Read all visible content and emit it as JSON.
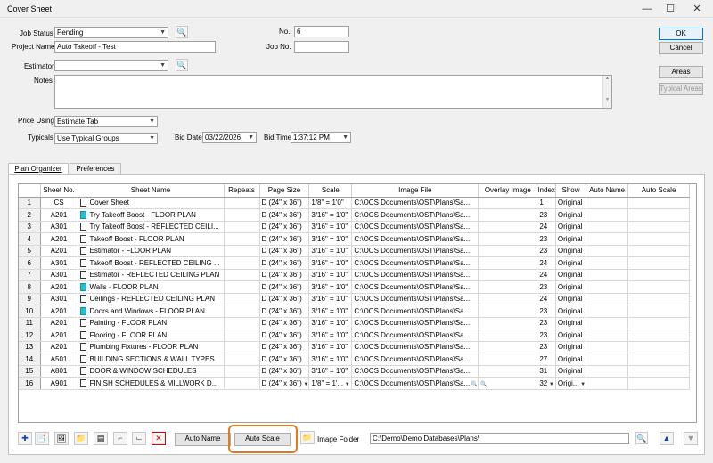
{
  "window": {
    "title": "Cover Sheet",
    "min": "—",
    "max": "☐",
    "close": "✕"
  },
  "form": {
    "job_status_label": "Job Status",
    "job_status_value": "Pending",
    "project_name_label": "Project Name",
    "project_name_value": "Auto Takeoff - Test",
    "estimator_label": "Estimator",
    "estimator_value": "",
    "notes_label": "Notes",
    "no_label": "No.",
    "no_value": "6",
    "job_no_label": "Job No.",
    "job_no_value": "",
    "price_using_label": "Price Using",
    "price_using_value": "Estimate Tab",
    "typicals_label": "Typicals",
    "typicals_value": "Use Typical Groups",
    "bid_date_label": "Bid Date",
    "bid_date_value": "03/22/2026",
    "bid_time_label": "Bid Time",
    "bid_time_value": "1:37:12 PM"
  },
  "buttons": {
    "ok": "OK",
    "cancel": "Cancel",
    "areas": "Areas",
    "typical_areas": "Typical Areas"
  },
  "tabs": [
    {
      "label": "Plan Organizer"
    },
    {
      "label": "Preferences"
    }
  ],
  "grid": {
    "columns": [
      "",
      "Sheet No.",
      "Sheet Name",
      "Repeats",
      "Page Size",
      "Scale",
      "Image File",
      "Overlay Image",
      "Index",
      "Show",
      "Auto Name",
      "Auto Scale"
    ],
    "rows": [
      {
        "n": "1",
        "sheet_no": "CS",
        "name": "Cover Sheet",
        "icon": "plain",
        "page_size": "D (24\" x 36\")",
        "scale": "1/8\" = 1'0\"",
        "image": "C:\\OCS Documents\\OST\\Plans\\Sa...",
        "index": "1",
        "show": "Original"
      },
      {
        "n": "2",
        "sheet_no": "A201",
        "name": "Try Takeoff Boost - FLOOR PLAN",
        "icon": "cyan",
        "page_size": "D (24\" x 36\")",
        "scale": "3/16\" = 1'0\"",
        "image": "C:\\OCS Documents\\OST\\Plans\\Sa...",
        "index": "23",
        "show": "Original"
      },
      {
        "n": "3",
        "sheet_no": "A301",
        "name": "Try Takeoff Boost - REFLECTED CEILI...",
        "icon": "plain",
        "page_size": "D (24\" x 36\")",
        "scale": "3/16\" = 1'0\"",
        "image": "C:\\OCS Documents\\OST\\Plans\\Sa...",
        "index": "24",
        "show": "Original"
      },
      {
        "n": "4",
        "sheet_no": "A201",
        "name": "Takeoff Boost - FLOOR PLAN",
        "icon": "plain",
        "page_size": "D (24\" x 36\")",
        "scale": "3/16\" = 1'0\"",
        "image": "C:\\OCS Documents\\OST\\Plans\\Sa...",
        "index": "23",
        "show": "Original"
      },
      {
        "n": "5",
        "sheet_no": "A201",
        "name": "Estimator - FLOOR PLAN",
        "icon": "plain",
        "page_size": "D (24\" x 36\")",
        "scale": "3/16\" = 1'0\"",
        "image": "C:\\OCS Documents\\OST\\Plans\\Sa...",
        "index": "23",
        "show": "Original"
      },
      {
        "n": "6",
        "sheet_no": "A301",
        "name": "Takeoff Boost - REFLECTED CEILING ...",
        "icon": "plain",
        "page_size": "D (24\" x 36\")",
        "scale": "3/16\" = 1'0\"",
        "image": "C:\\OCS Documents\\OST\\Plans\\Sa...",
        "index": "24",
        "show": "Original"
      },
      {
        "n": "7",
        "sheet_no": "A301",
        "name": "Estimator - REFLECTED CEILING PLAN",
        "icon": "plain",
        "page_size": "D (24\" x 36\")",
        "scale": "3/16\" = 1'0\"",
        "image": "C:\\OCS Documents\\OST\\Plans\\Sa...",
        "index": "24",
        "show": "Original"
      },
      {
        "n": "8",
        "sheet_no": "A201",
        "name": "Walls - FLOOR PLAN",
        "icon": "cyan",
        "page_size": "D (24\" x 36\")",
        "scale": "3/16\" = 1'0\"",
        "image": "C:\\OCS Documents\\OST\\Plans\\Sa...",
        "index": "23",
        "show": "Original"
      },
      {
        "n": "9",
        "sheet_no": "A301",
        "name": "Ceilings - REFLECTED CEILING PLAN",
        "icon": "plain",
        "page_size": "D (24\" x 36\")",
        "scale": "3/16\" = 1'0\"",
        "image": "C:\\OCS Documents\\OST\\Plans\\Sa...",
        "index": "24",
        "show": "Original"
      },
      {
        "n": "10",
        "sheet_no": "A201",
        "name": "Doors and Windows - FLOOR PLAN",
        "icon": "cyan",
        "page_size": "D (24\" x 36\")",
        "scale": "3/16\" = 1'0\"",
        "image": "C:\\OCS Documents\\OST\\Plans\\Sa...",
        "index": "23",
        "show": "Original"
      },
      {
        "n": "11",
        "sheet_no": "A201",
        "name": "Painting - FLOOR PLAN",
        "icon": "plain",
        "page_size": "D (24\" x 36\")",
        "scale": "3/16\" = 1'0\"",
        "image": "C:\\OCS Documents\\OST\\Plans\\Sa...",
        "index": "23",
        "show": "Original"
      },
      {
        "n": "12",
        "sheet_no": "A201",
        "name": "Flooring - FLOOR PLAN",
        "icon": "plain",
        "page_size": "D (24\" x 36\")",
        "scale": "3/16\" = 1'0\"",
        "image": "C:\\OCS Documents\\OST\\Plans\\Sa...",
        "index": "23",
        "show": "Original"
      },
      {
        "n": "13",
        "sheet_no": "A201",
        "name": "Plumbing Fixtures - FLOOR PLAN",
        "icon": "plain",
        "page_size": "D (24\" x 36\")",
        "scale": "3/16\" = 1'0\"",
        "image": "C:\\OCS Documents\\OST\\Plans\\Sa...",
        "index": "23",
        "show": "Original"
      },
      {
        "n": "14",
        "sheet_no": "A501",
        "name": "BUILDING SECTIONS & WALL TYPES",
        "icon": "plain",
        "page_size": "D (24\" x 36\")",
        "scale": "3/16\" = 1'0\"",
        "image": "C:\\OCS Documents\\OST\\Plans\\Sa...",
        "index": "27",
        "show": "Original"
      },
      {
        "n": "15",
        "sheet_no": "A801",
        "name": "DOOR & WINDOW SCHEDULES",
        "icon": "plain",
        "page_size": "D (24\" x 36\")",
        "scale": "3/16\" = 1'0\"",
        "image": "C:\\OCS Documents\\OST\\Plans\\Sa...",
        "index": "31",
        "show": "Original"
      },
      {
        "n": "16",
        "sheet_no": "A901",
        "name": "FINISH SCHEDULES & MILLWORK D...",
        "icon": "plain",
        "page_size": "D (24\" x 36\")",
        "scale": "1/8\" = 1'...",
        "image": "C:\\OCS Documents\\OST\\Plans\\Sa...",
        "index": "32",
        "show": "Origi..."
      }
    ]
  },
  "bottom": {
    "auto_name": "Auto Name",
    "auto_scale": "Auto Scale",
    "image_folder_label": "Image Folder",
    "image_folder_value": "C:\\Demo\\Demo Databases\\Plans\\"
  }
}
